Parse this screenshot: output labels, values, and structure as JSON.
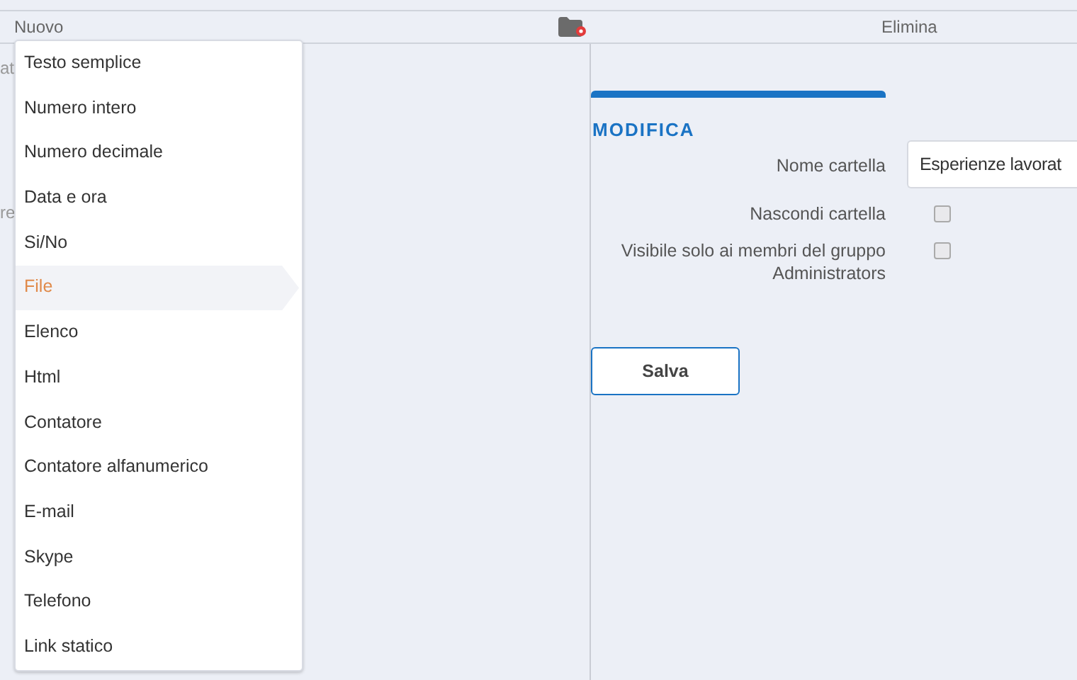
{
  "toolbar": {
    "new_label": "Nuovo",
    "delete_label": "Elimina"
  },
  "left_panel": {
    "fragments": [
      "at",
      "re"
    ]
  },
  "menu": {
    "items": [
      {
        "label": "Testo semplice",
        "selected": false
      },
      {
        "label": "Numero intero",
        "selected": false
      },
      {
        "label": "Numero decimale",
        "selected": false
      },
      {
        "label": "Data e ora",
        "selected": false
      },
      {
        "label": "Si/No",
        "selected": false
      },
      {
        "label": "File",
        "selected": true
      },
      {
        "label": "Elenco",
        "selected": false
      },
      {
        "label": "Html",
        "selected": false
      },
      {
        "label": "Contatore",
        "selected": false
      },
      {
        "label": "Contatore alfanumerico",
        "selected": false
      },
      {
        "label": "E-mail",
        "selected": false
      },
      {
        "label": "Skype",
        "selected": false
      },
      {
        "label": "Telefono",
        "selected": false
      },
      {
        "label": "Link statico",
        "selected": false
      }
    ]
  },
  "form": {
    "title": "MODIFICA",
    "fields": [
      {
        "kind": "text",
        "label": "Nome cartella",
        "value": "Esperienze lavorat"
      },
      {
        "kind": "checkbox",
        "label": "Nascondi cartella",
        "checked": false
      },
      {
        "kind": "checkbox",
        "label": "Visibile solo ai membri del gruppo Administrators",
        "checked": false
      }
    ],
    "save_label": "Salva"
  }
}
